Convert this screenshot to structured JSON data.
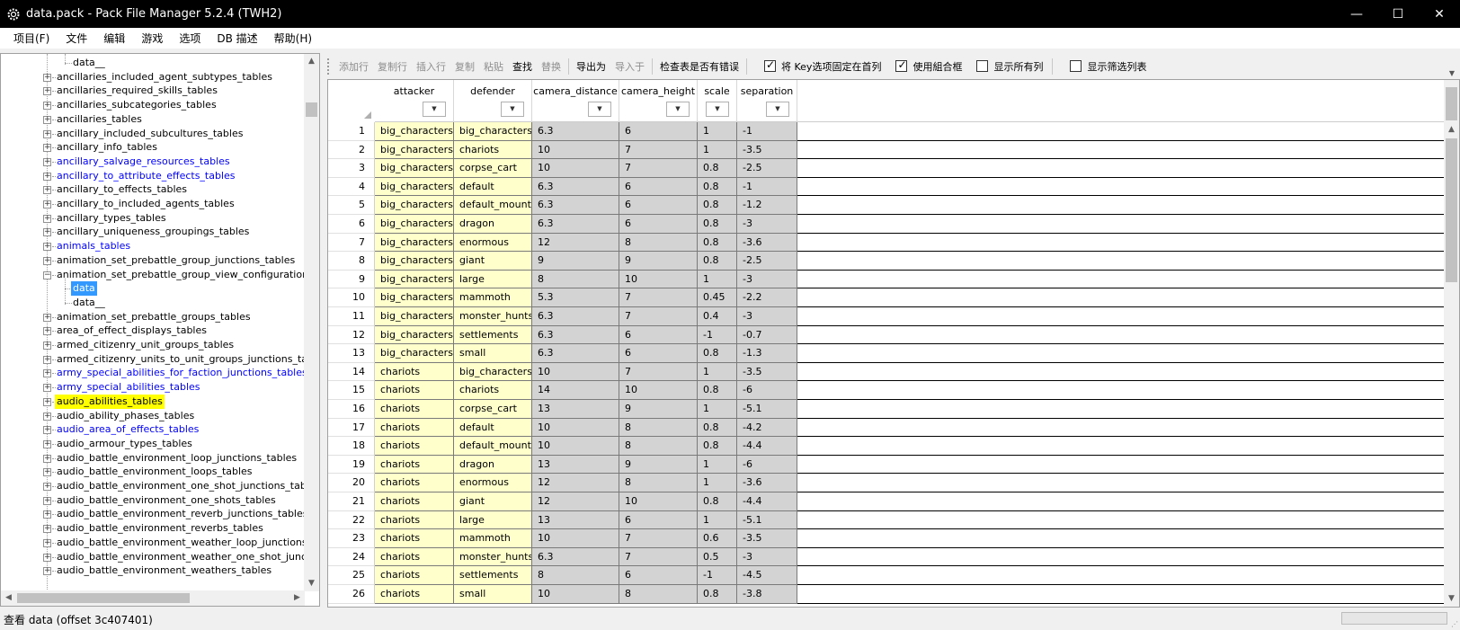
{
  "window": {
    "title": "data.pack - Pack File Manager 5.2.4 (TWH2)",
    "minimize": "—",
    "maximize": "☐",
    "close": "✕"
  },
  "menu": [
    "项目(F)",
    "文件",
    "编辑",
    "游戏",
    "选项",
    "DB 描述",
    "帮助(H)"
  ],
  "tree": {
    "items": [
      {
        "label": "data__",
        "level": 2,
        "color": "black"
      },
      {
        "label": "ancillaries_included_agent_subtypes_tables",
        "level": 1,
        "color": "black"
      },
      {
        "label": "ancillaries_required_skills_tables",
        "level": 1,
        "color": "black"
      },
      {
        "label": "ancillaries_subcategories_tables",
        "level": 1,
        "color": "black"
      },
      {
        "label": "ancillaries_tables",
        "level": 1,
        "color": "black"
      },
      {
        "label": "ancillary_included_subcultures_tables",
        "level": 1,
        "color": "black"
      },
      {
        "label": "ancillary_info_tables",
        "level": 1,
        "color": "black"
      },
      {
        "label": "ancillary_salvage_resources_tables",
        "level": 1,
        "color": "blue"
      },
      {
        "label": "ancillary_to_attribute_effects_tables",
        "level": 1,
        "color": "blue"
      },
      {
        "label": "ancillary_to_effects_tables",
        "level": 1,
        "color": "black"
      },
      {
        "label": "ancillary_to_included_agents_tables",
        "level": 1,
        "color": "black"
      },
      {
        "label": "ancillary_types_tables",
        "level": 1,
        "color": "black"
      },
      {
        "label": "ancillary_uniqueness_groupings_tables",
        "level": 1,
        "color": "black"
      },
      {
        "label": "animals_tables",
        "level": 1,
        "color": "blue"
      },
      {
        "label": "animation_set_prebattle_group_junctions_tables",
        "level": 1,
        "color": "black"
      },
      {
        "label": "animation_set_prebattle_group_view_configurations_table",
        "level": 1,
        "color": "black",
        "expanded": true
      },
      {
        "label": "data",
        "level": 2,
        "color": "selected"
      },
      {
        "label": "data__",
        "level": 2,
        "color": "black"
      },
      {
        "label": "animation_set_prebattle_groups_tables",
        "level": 1,
        "color": "black"
      },
      {
        "label": "area_of_effect_displays_tables",
        "level": 1,
        "color": "black"
      },
      {
        "label": "armed_citizenry_unit_groups_tables",
        "level": 1,
        "color": "black"
      },
      {
        "label": "armed_citizenry_units_to_unit_groups_junctions_tables",
        "level": 1,
        "color": "black"
      },
      {
        "label": "army_special_abilities_for_faction_junctions_tables",
        "level": 1,
        "color": "blue"
      },
      {
        "label": "army_special_abilities_tables",
        "level": 1,
        "color": "blue"
      },
      {
        "label": "audio_abilities_tables",
        "level": 1,
        "color": "highlight"
      },
      {
        "label": "audio_ability_phases_tables",
        "level": 1,
        "color": "black"
      },
      {
        "label": "audio_area_of_effects_tables",
        "level": 1,
        "color": "blue"
      },
      {
        "label": "audio_armour_types_tables",
        "level": 1,
        "color": "black"
      },
      {
        "label": "audio_battle_environment_loop_junctions_tables",
        "level": 1,
        "color": "black"
      },
      {
        "label": "audio_battle_environment_loops_tables",
        "level": 1,
        "color": "black"
      },
      {
        "label": "audio_battle_environment_one_shot_junctions_tables",
        "level": 1,
        "color": "black"
      },
      {
        "label": "audio_battle_environment_one_shots_tables",
        "level": 1,
        "color": "black"
      },
      {
        "label": "audio_battle_environment_reverb_junctions_tables",
        "level": 1,
        "color": "black"
      },
      {
        "label": "audio_battle_environment_reverbs_tables",
        "level": 1,
        "color": "black"
      },
      {
        "label": "audio_battle_environment_weather_loop_junctions_tables",
        "level": 1,
        "color": "black"
      },
      {
        "label": "audio_battle_environment_weather_one_shot_junctions_t",
        "level": 1,
        "color": "black"
      },
      {
        "label": "audio_battle_environment_weathers_tables",
        "level": 1,
        "color": "black"
      }
    ]
  },
  "toolbar": {
    "add_row": "添加行",
    "copy_row": "复制行",
    "insert_row": "插入行",
    "copy": "复制",
    "paste": "粘贴",
    "find": "查找",
    "replace": "替换",
    "export": "导出为",
    "import": "导入于",
    "check_errors": "检查表是否有错误",
    "pin_keys": "将 Key选项固定在首列",
    "use_combo": "使用組合框",
    "show_all_cols": "显示所有列",
    "show_filter": "显示筛选列表"
  },
  "toolbar_state": {
    "pin_keys": true,
    "use_combo": true,
    "show_all_cols": false,
    "show_filter": false
  },
  "grid": {
    "columns": [
      "attacker",
      "defender",
      "camera_distance",
      "camera_height",
      "scale",
      "separation"
    ],
    "filter_glyph": "▼",
    "rows": [
      [
        "1",
        "big_characters",
        "big_characters",
        "6.3",
        "6",
        "1",
        "-1"
      ],
      [
        "2",
        "big_characters",
        "chariots",
        "10",
        "7",
        "1",
        "-3.5"
      ],
      [
        "3",
        "big_characters",
        "corpse_cart",
        "10",
        "7",
        "0.8",
        "-2.5"
      ],
      [
        "4",
        "big_characters",
        "default",
        "6.3",
        "6",
        "0.8",
        "-1"
      ],
      [
        "5",
        "big_characters",
        "default_mounted",
        "6.3",
        "6",
        "0.8",
        "-1.2"
      ],
      [
        "6",
        "big_characters",
        "dragon",
        "6.3",
        "6",
        "0.8",
        "-3"
      ],
      [
        "7",
        "big_characters",
        "enormous",
        "12",
        "8",
        "0.8",
        "-3.6"
      ],
      [
        "8",
        "big_characters",
        "giant",
        "9",
        "9",
        "0.8",
        "-2.5"
      ],
      [
        "9",
        "big_characters",
        "large",
        "8",
        "10",
        "1",
        "-3"
      ],
      [
        "10",
        "big_characters",
        "mammoth",
        "5.3",
        "7",
        "0.45",
        "-2.2"
      ],
      [
        "11",
        "big_characters",
        "monster_hunts",
        "6.3",
        "7",
        "0.4",
        "-3"
      ],
      [
        "12",
        "big_characters",
        "settlements",
        "6.3",
        "6",
        "-1",
        "-0.7"
      ],
      [
        "13",
        "big_characters",
        "small",
        "6.3",
        "6",
        "0.8",
        "-1.3"
      ],
      [
        "14",
        "chariots",
        "big_characters",
        "10",
        "7",
        "1",
        "-3.5"
      ],
      [
        "15",
        "chariots",
        "chariots",
        "14",
        "10",
        "0.8",
        "-6"
      ],
      [
        "16",
        "chariots",
        "corpse_cart",
        "13",
        "9",
        "1",
        "-5.1"
      ],
      [
        "17",
        "chariots",
        "default",
        "10",
        "8",
        "0.8",
        "-4.2"
      ],
      [
        "18",
        "chariots",
        "default_mounted",
        "10",
        "8",
        "0.8",
        "-4.4"
      ],
      [
        "19",
        "chariots",
        "dragon",
        "13",
        "9",
        "1",
        "-6"
      ],
      [
        "20",
        "chariots",
        "enormous",
        "12",
        "8",
        "1",
        "-3.6"
      ],
      [
        "21",
        "chariots",
        "giant",
        "12",
        "10",
        "0.8",
        "-4.4"
      ],
      [
        "22",
        "chariots",
        "large",
        "13",
        "6",
        "1",
        "-5.1"
      ],
      [
        "23",
        "chariots",
        "mammoth",
        "10",
        "7",
        "0.6",
        "-3.5"
      ],
      [
        "24",
        "chariots",
        "monster_hunts",
        "6.3",
        "7",
        "0.5",
        "-3"
      ],
      [
        "25",
        "chariots",
        "settlements",
        "8",
        "6",
        "-1",
        "-4.5"
      ],
      [
        "26",
        "chariots",
        "small",
        "10",
        "8",
        "0.8",
        "-3.8"
      ]
    ]
  },
  "status": {
    "text": "查看 data (offset 3c407401)"
  }
}
